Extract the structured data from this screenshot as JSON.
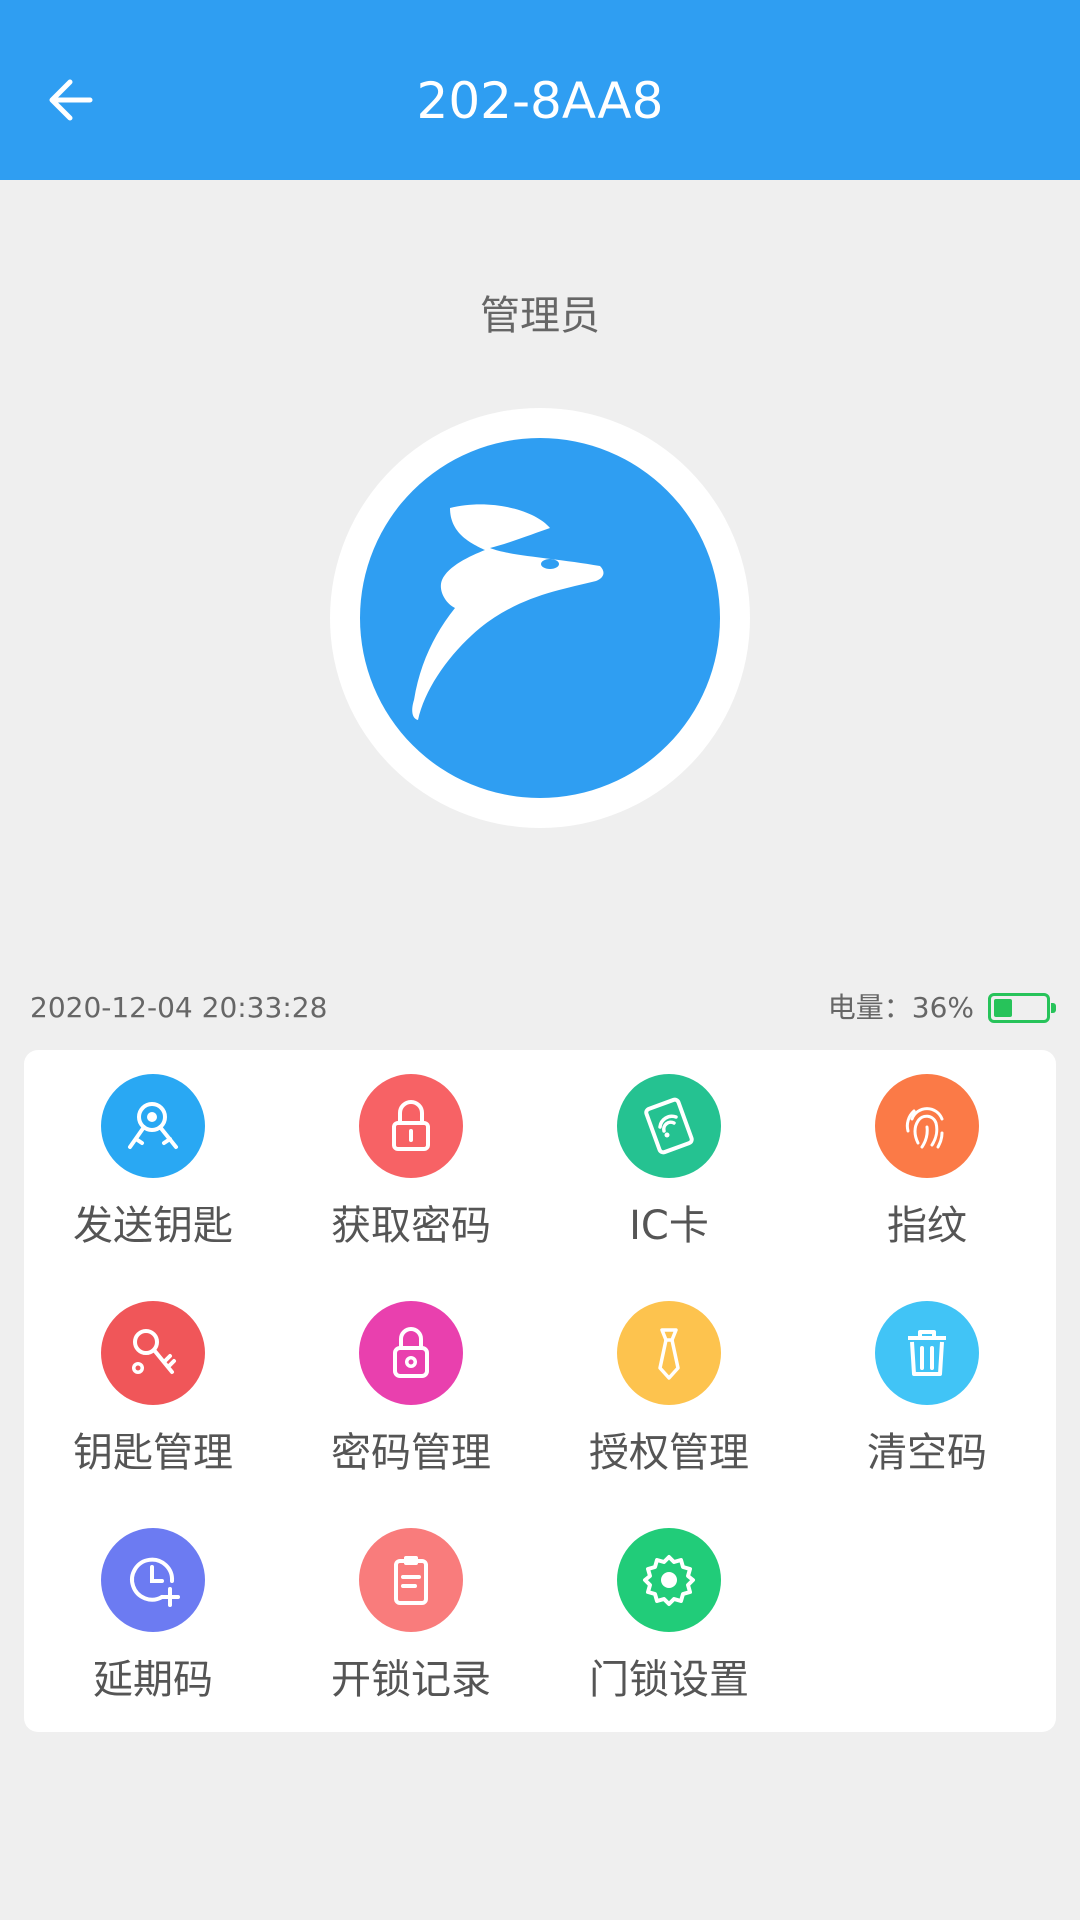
{
  "header": {
    "title": "202-8AA8"
  },
  "role_label": "管理员",
  "status": {
    "datetime": "2020-12-04 20:33:28",
    "battery_label": "电量：36%",
    "battery_level": 0.36
  },
  "colors": {
    "primary": "#2f9ef2",
    "battery": "#27c35a"
  },
  "menu": [
    {
      "label": "发送钥匙",
      "icon": "send-key-icon",
      "color": "#29a8f3"
    },
    {
      "label": "获取密码",
      "icon": "lock-icon",
      "color": "#f76265"
    },
    {
      "label": "IC卡",
      "icon": "ic-card-icon",
      "color": "#25c291"
    },
    {
      "label": "指纹",
      "icon": "fingerprint-icon",
      "color": "#fb7a47"
    },
    {
      "label": "钥匙管理",
      "icon": "key-manage-icon",
      "color": "#f05659"
    },
    {
      "label": "密码管理",
      "icon": "password-manage-icon",
      "color": "#e940ae"
    },
    {
      "label": "授权管理",
      "icon": "tie-icon",
      "color": "#fdc34e"
    },
    {
      "label": "清空码",
      "icon": "trash-icon",
      "color": "#41c4f6"
    },
    {
      "label": "延期码",
      "icon": "clock-add-icon",
      "color": "#6c7bf2"
    },
    {
      "label": "开锁记录",
      "icon": "clipboard-icon",
      "color": "#f97c7c"
    },
    {
      "label": "门锁设置",
      "icon": "gear-icon",
      "color": "#21cc79"
    }
  ]
}
